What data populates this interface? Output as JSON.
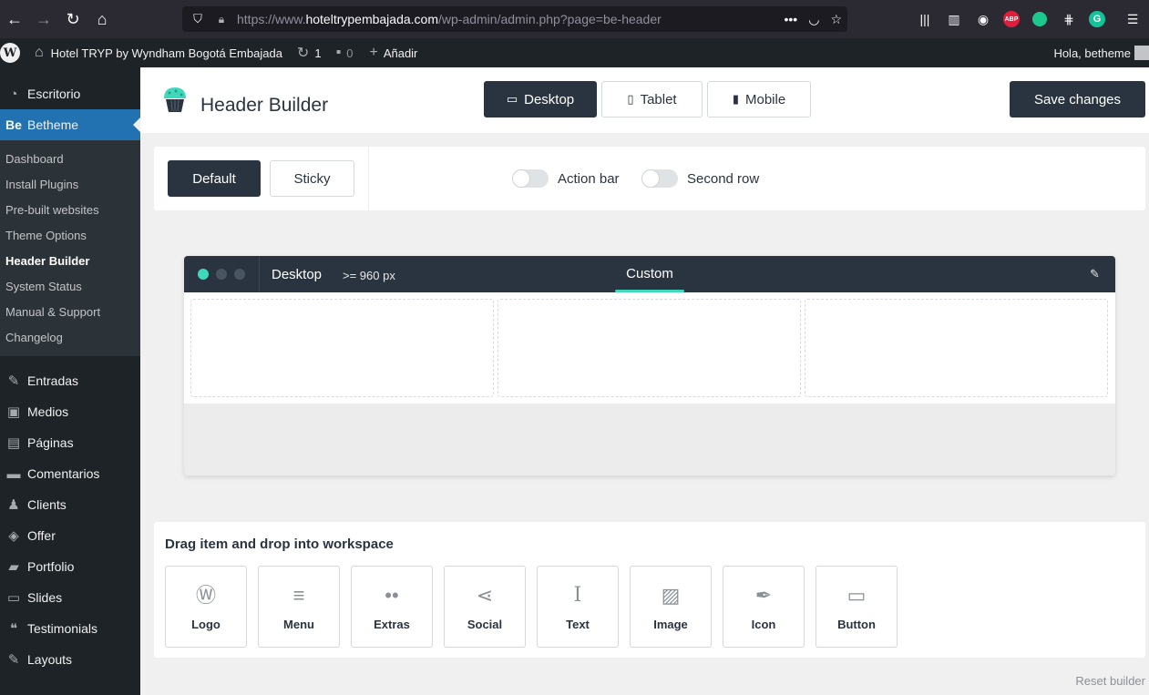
{
  "browser": {
    "url_prefix": "https://www.",
    "url_domain": "hoteltrypembajada.com",
    "url_path": "/wp-admin/admin.php?page=be-header",
    "icons": [
      "back-icon",
      "forward-icon",
      "reload-icon",
      "home-icon",
      "shield-icon",
      "lock-icon",
      "more-icon",
      "pocket-icon",
      "star-icon",
      "library-icon",
      "sidebar-icon",
      "account-icon",
      "adblock-icon",
      "extension-icon",
      "grid-icon",
      "grammarly-icon",
      "menu-icon"
    ],
    "abp_label": "ABP",
    "grammarly_label": "G"
  },
  "admin_bar": {
    "site_name": "Hotel TRYP by Wyndham Bogotá Embajada",
    "updates_count": "1",
    "comments_count": "0",
    "new_label": "Añadir",
    "greeting": "Hola, betheme"
  },
  "sidebar": {
    "top_items": [
      {
        "label": "Escritorio",
        "icon": "dashboard-icon"
      },
      {
        "label": "Betheme",
        "icon": "be-icon",
        "icon_text": "Be"
      }
    ],
    "submenu": [
      {
        "label": "Dashboard"
      },
      {
        "label": "Install Plugins"
      },
      {
        "label": "Pre-built websites"
      },
      {
        "label": "Theme Options"
      },
      {
        "label": "Header Builder",
        "current": true
      },
      {
        "label": "System Status"
      },
      {
        "label": "Manual & Support"
      },
      {
        "label": "Changelog"
      }
    ],
    "bottom_items": [
      {
        "label": "Entradas",
        "icon": "pin-icon"
      },
      {
        "label": "Medios",
        "icon": "media-icon"
      },
      {
        "label": "Páginas",
        "icon": "pages-icon"
      },
      {
        "label": "Comentarios",
        "icon": "comments-icon"
      },
      {
        "label": "Clients",
        "icon": "clients-icon"
      },
      {
        "label": "Offer",
        "icon": "offer-icon"
      },
      {
        "label": "Portfolio",
        "icon": "portfolio-icon"
      },
      {
        "label": "Slides",
        "icon": "slides-icon"
      },
      {
        "label": "Testimonials",
        "icon": "quote-icon"
      },
      {
        "label": "Layouts",
        "icon": "layouts-icon"
      }
    ]
  },
  "header_builder": {
    "title": "Header Builder",
    "devices": [
      {
        "label": "Desktop",
        "icon": "desktop-icon",
        "active": true
      },
      {
        "label": "Tablet",
        "icon": "tablet-icon"
      },
      {
        "label": "Mobile",
        "icon": "mobile-icon"
      }
    ],
    "save_label": "Save changes",
    "states": {
      "default_label": "Default",
      "sticky_label": "Sticky"
    },
    "toggles": {
      "action_bar_label": "Action bar",
      "second_row_label": "Second row",
      "action_bar_on": false,
      "second_row_on": false
    },
    "workspace": {
      "device_label": "Desktop",
      "width_label": ">= 960 px",
      "tab_label": "Custom",
      "accent": "#3fd8bb"
    },
    "items_title": "Drag item and drop into workspace",
    "items": [
      {
        "label": "Logo",
        "icon": "wordpress-icon"
      },
      {
        "label": "Menu",
        "icon": "menu-lines-icon"
      },
      {
        "label": "Extras",
        "icon": "extras-dots-icon"
      },
      {
        "label": "Social",
        "icon": "share-icon"
      },
      {
        "label": "Text",
        "icon": "text-cursor-icon"
      },
      {
        "label": "Image",
        "icon": "image-icon"
      },
      {
        "label": "Icon",
        "icon": "feather-icon"
      },
      {
        "label": "Button",
        "icon": "button-icon"
      }
    ],
    "reset_label": "Reset builder"
  },
  "colors": {
    "dark": "#2a3440",
    "wp_blue": "#2271b1",
    "admin_bg": "#1d2327"
  }
}
